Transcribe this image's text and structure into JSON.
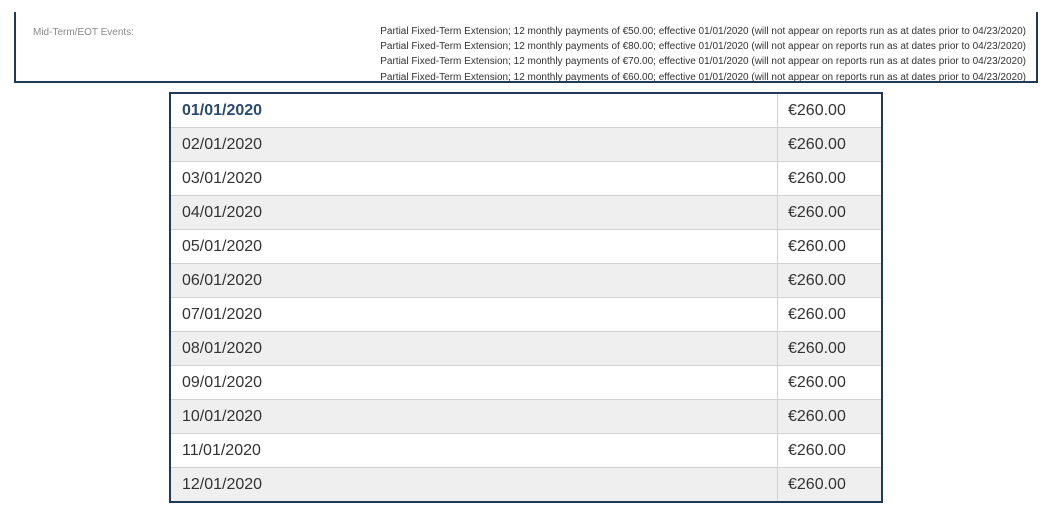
{
  "events": {
    "label": "Mid-Term/EOT Events:",
    "items": [
      "Partial Fixed-Term Extension; 12 monthly payments of €50.00; effective 01/01/2020 (will not appear on reports run as at dates prior to 04/23/2020)",
      "Partial Fixed-Term Extension; 12 monthly payments of €80.00; effective 01/01/2020 (will not appear on reports run as at dates prior to 04/23/2020)",
      "Partial Fixed-Term Extension; 12 monthly payments of €70.00; effective 01/01/2020 (will not appear on reports run as at dates prior to 04/23/2020)",
      "Partial Fixed-Term Extension; 12 monthly payments of €60.00; effective 01/01/2020 (will not appear on reports run as at dates prior to 04/23/2020)"
    ]
  },
  "payments": {
    "rows": [
      {
        "date": "01/01/2020",
        "amount": "€260.00"
      },
      {
        "date": "02/01/2020",
        "amount": "€260.00"
      },
      {
        "date": "03/01/2020",
        "amount": "€260.00"
      },
      {
        "date": "04/01/2020",
        "amount": "€260.00"
      },
      {
        "date": "05/01/2020",
        "amount": "€260.00"
      },
      {
        "date": "06/01/2020",
        "amount": "€260.00"
      },
      {
        "date": "07/01/2020",
        "amount": "€260.00"
      },
      {
        "date": "08/01/2020",
        "amount": "€260.00"
      },
      {
        "date": "09/01/2020",
        "amount": "€260.00"
      },
      {
        "date": "10/01/2020",
        "amount": "€260.00"
      },
      {
        "date": "11/01/2020",
        "amount": "€260.00"
      },
      {
        "date": "12/01/2020",
        "amount": "€260.00"
      }
    ]
  },
  "colors": {
    "border": "#1f3a56",
    "highlight_text": "#2c4a6b",
    "alt_row": "#efefef"
  }
}
